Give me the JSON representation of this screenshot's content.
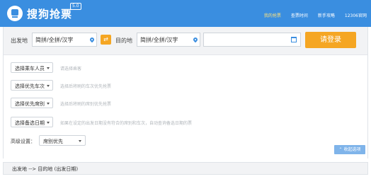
{
  "header": {
    "app_title": "搜狗抢票",
    "version": "5.0",
    "nav": [
      {
        "label": "我的抢票",
        "active": true
      },
      {
        "label": "查票时间",
        "active": false
      },
      {
        "label": "新手攻略",
        "active": false
      },
      {
        "label": "12306官网",
        "active": false
      }
    ]
  },
  "search": {
    "from_label": "出发地",
    "from_value": "简拼/全拼/汉字",
    "swap_icon": "swap-icon",
    "to_label": "目的地",
    "to_value": "简拼/全拼/汉字",
    "date_value": "",
    "login_label": "请登录"
  },
  "options": [
    {
      "label": "选择乘车人员",
      "hint": "请选择乘客"
    },
    {
      "label": "选择优先车次",
      "hint": "选择后将刷的车次优先抢票"
    },
    {
      "label": "选择优先席别",
      "hint": "选择后将刷的席别优先抢票"
    },
    {
      "label": "选择备选日期",
      "hint": "如果在设定的出发日期没有符合的席别和车次，自动查询备选日期的票"
    }
  ],
  "advanced": {
    "label": "高级设置：",
    "value": "席别优先"
  },
  "collapse_label": "收起选项",
  "result_bar_text": "出发地 --> 目的地 (出发日期)",
  "colors": {
    "header_bg": "#3a8ee0",
    "accent_orange": "#f5a623"
  }
}
